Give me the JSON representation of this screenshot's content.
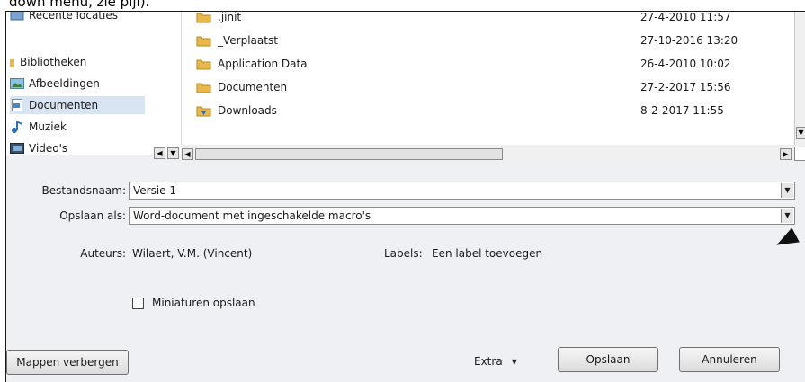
{
  "doc_text": "down menu, zie pijl).",
  "nav_pane": {
    "items": [
      {
        "label": "Recente locaties",
        "icon": "recent-places-icon"
      },
      {
        "label": "Bibliotheken",
        "icon": "libraries-icon"
      },
      {
        "label": "Afbeeldingen",
        "icon": "pictures-icon"
      },
      {
        "label": "Documenten",
        "icon": "documents-icon",
        "selected": true
      },
      {
        "label": "Muziek",
        "icon": "music-icon"
      },
      {
        "label": "Video's",
        "icon": "videos-icon"
      }
    ]
  },
  "file_list": {
    "rows": [
      {
        "name": ".jinit",
        "date": "27-4-2010 11:57"
      },
      {
        "name": "_Verplaatst",
        "date": "27-10-2016 13:20"
      },
      {
        "name": "Application Data",
        "date": "26-4-2010 10:02"
      },
      {
        "name": "Documenten",
        "date": "27-2-2017 15:56"
      },
      {
        "name": "Downloads",
        "date": "8-2-2017 11:55"
      }
    ]
  },
  "form": {
    "filename_label": "Bestandsnaam:",
    "filename_value": "Versie 1",
    "savetype_label": "Opslaan als:",
    "savetype_value": "Word-document met ingeschakelde macro's",
    "authors_label": "Auteurs:",
    "authors_value": "Wilaert, V.M. (Vincent)",
    "labels_label": "Labels:",
    "labels_value": "Een label toevoegen",
    "thumbnail_label": "Miniaturen opslaan"
  },
  "buttons": {
    "hide_folders": "Mappen verbergen",
    "extra": "Extra",
    "save": "Opslaan",
    "cancel": "Annuleren"
  },
  "colors": {
    "folder": "#e8b84a",
    "selected": "#d9e4f2",
    "pointer": "#111111"
  }
}
